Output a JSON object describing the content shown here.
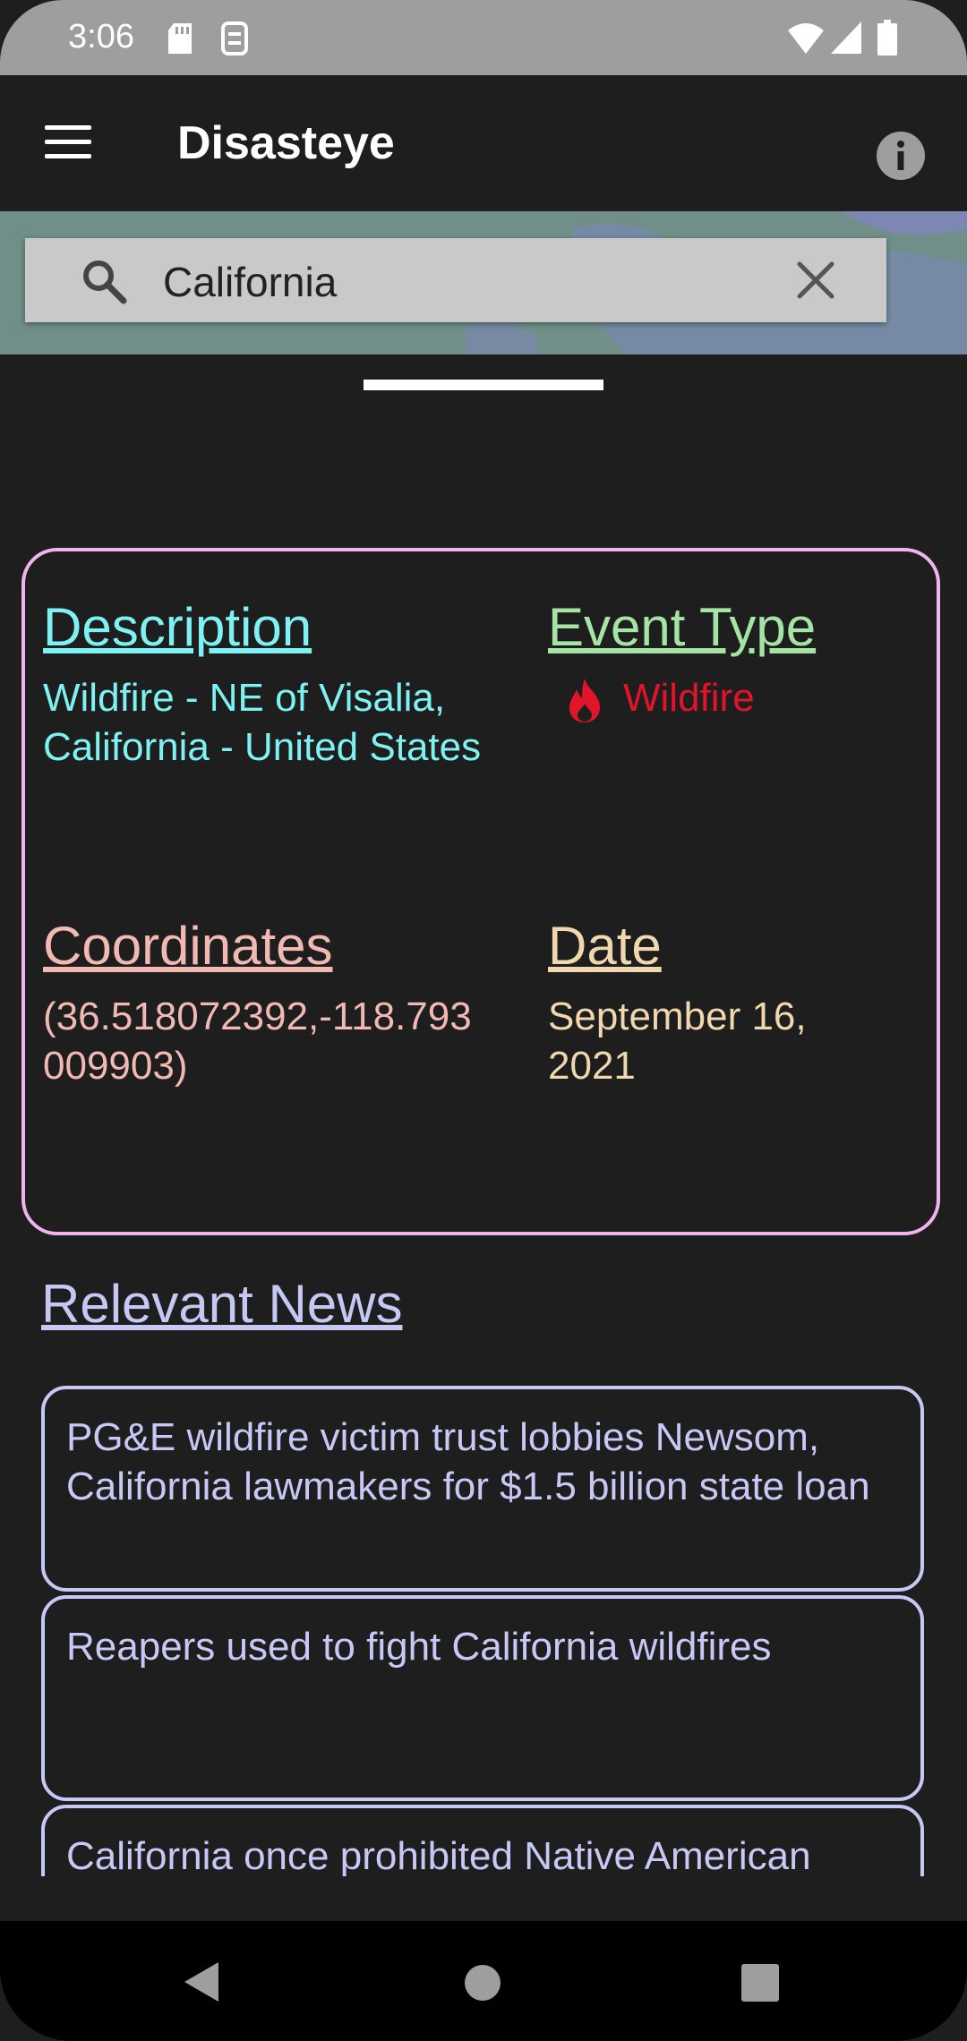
{
  "status_bar": {
    "time": "3:06"
  },
  "app_bar": {
    "title": "Disasteye"
  },
  "search": {
    "query": "California"
  },
  "details": {
    "description_label": "Description",
    "description_value": "Wildfire - NE of Visalia, California - United States",
    "event_type_label": "Event Type",
    "event_type_value": "Wildfire",
    "coordinates_label": "Coordinates",
    "coordinates_value": "(36.518072392,-118.793009903)",
    "date_label": "Date",
    "date_value": "September 16, 2021"
  },
  "news": {
    "title": "Relevant News",
    "items": [
      "PG&E wildfire victim trust lobbies Newsom, California lawmakers for $1.5 billion state loan",
      "Reapers used to fight California wildfires",
      "California once prohibited Native American"
    ]
  },
  "colors": {
    "description": "#7ef2f2",
    "event_type_head": "#a4e4a4",
    "wildfire": "#e2142a",
    "coordinates": "#f2b8b2",
    "date": "#f0d7ae",
    "card_border": "#f0b4ee",
    "news": "#c8c8f6"
  },
  "icons": [
    "menu-icon",
    "info-icon",
    "search-icon",
    "close-icon",
    "fire-icon",
    "back-icon",
    "home-icon",
    "recents-icon"
  ]
}
